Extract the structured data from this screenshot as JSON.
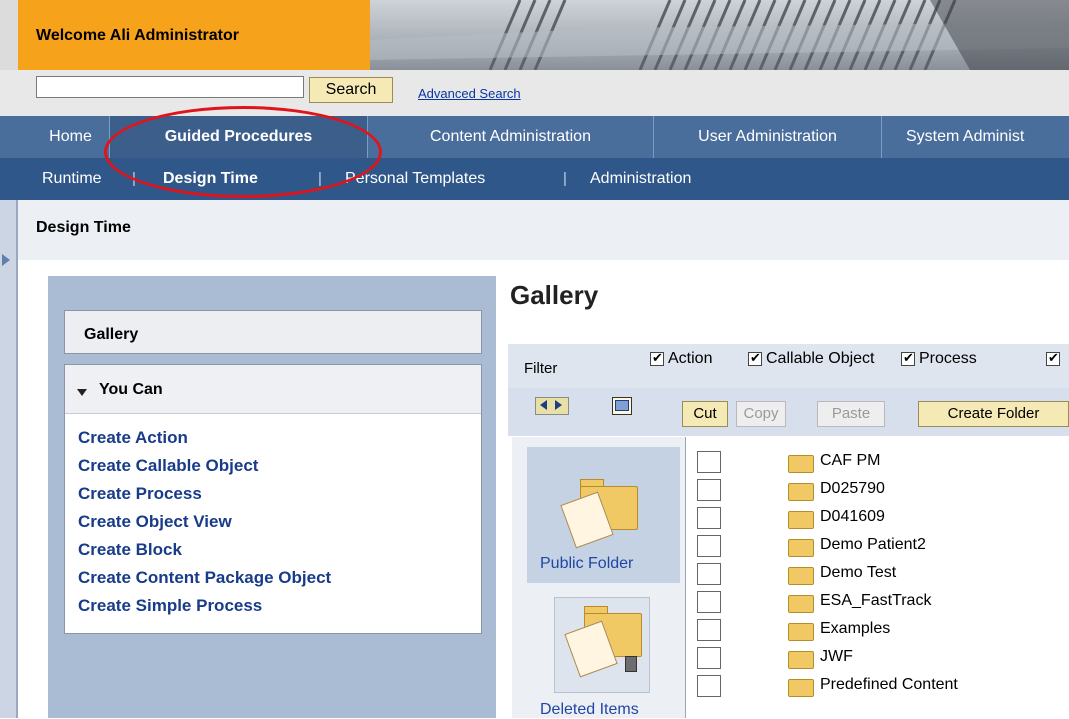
{
  "header": {
    "welcome": "Welcome Ali Administrator",
    "search_placeholder": "",
    "search_button": "Search",
    "advanced_search": "Advanced Search"
  },
  "top_nav": [
    {
      "label": "Home"
    },
    {
      "label": "Guided Procedures",
      "active": true
    },
    {
      "label": "Content Administration"
    },
    {
      "label": "User Administration"
    },
    {
      "label": "System Administ"
    }
  ],
  "sub_nav": [
    {
      "label": "Runtime"
    },
    {
      "label": "Design Time",
      "active": true
    },
    {
      "label": "Personal Templates"
    },
    {
      "label": "Administration"
    }
  ],
  "page": {
    "title": "Design Time"
  },
  "left_panel": {
    "gallery_label": "Gallery",
    "you_can_label": "You Can",
    "actions": [
      "Create Action",
      "Create Callable Object",
      "Create Process",
      "Create Object View",
      "Create Block",
      "Create Content Package Object",
      "Create Simple Process"
    ]
  },
  "gallery": {
    "title": "Gallery",
    "filter_label": "Filter",
    "filters": [
      {
        "label": "Action",
        "checked": true
      },
      {
        "label": "Callable Object",
        "checked": true
      },
      {
        "label": "Process",
        "checked": true
      },
      {
        "label": "",
        "checked": true
      }
    ],
    "toolbar": {
      "cut": "Cut",
      "copy": "Copy",
      "paste": "Paste",
      "create_folder": "Create Folder"
    },
    "folders": [
      {
        "label": "Public Folder",
        "icon": "public-folder-icon",
        "selected": true
      },
      {
        "label": "Deleted Items",
        "icon": "deleted-items-icon",
        "selected": false
      }
    ],
    "items": [
      "CAF PM",
      "D025790",
      "D041609",
      "Demo Patient2",
      "Demo Test",
      "ESA_FastTrack",
      "Examples",
      "JWF",
      "Predefined Content"
    ]
  },
  "annotation": {
    "color": "#e0151b",
    "target": "Guided Procedures"
  },
  "colors": {
    "welcome_bg": "#f6a21b",
    "nav_bg": "#4a6e9c",
    "subnav_bg": "#2f5789",
    "link": "#183b8a"
  }
}
